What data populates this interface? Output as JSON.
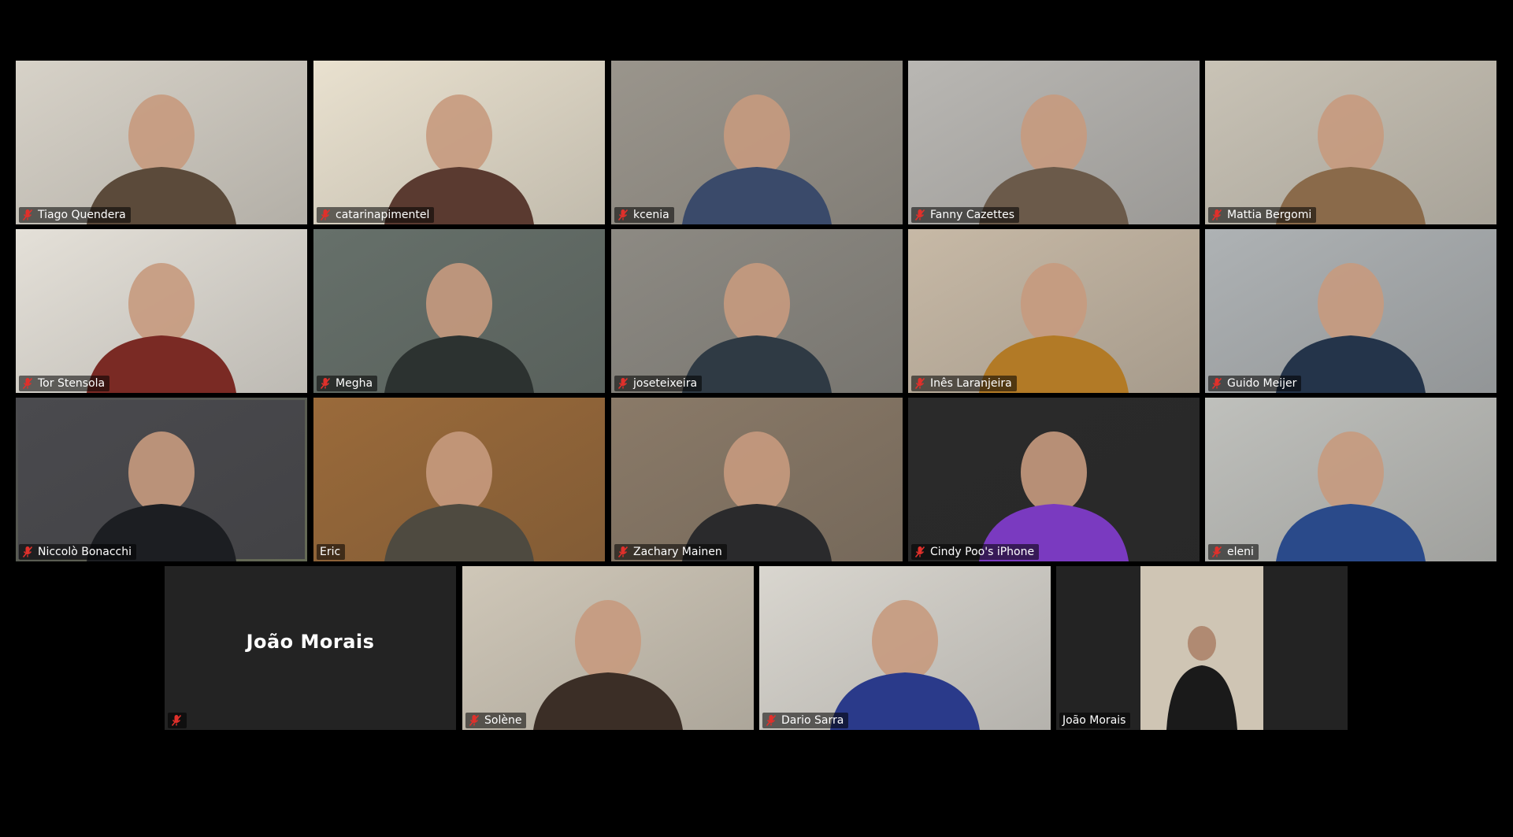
{
  "meeting": {
    "participants": [
      {
        "name": "Tiago Quendera",
        "muted": true,
        "bg": [
          "#d7d2c8",
          "#5b4a3a"
        ]
      },
      {
        "name": "catarinapimentel",
        "muted": true,
        "bg": [
          "#e9e1cf",
          "#5a3a30"
        ]
      },
      {
        "name": "kcenia",
        "muted": true,
        "bg": [
          "#9a958c",
          "#3a4a6a"
        ]
      },
      {
        "name": "Fanny Cazettes",
        "muted": true,
        "bg": [
          "#b9b7b3",
          "#6b5a4a"
        ]
      },
      {
        "name": "Mattia Bergomi",
        "muted": true,
        "bg": [
          "#c9c3b6",
          "#8a6a4a"
        ]
      },
      {
        "name": "Tor Stensola",
        "muted": true,
        "bg": [
          "#e4e0d8",
          "#7a2a24"
        ]
      },
      {
        "name": "Megha",
        "muted": true,
        "bg": [
          "#66706a",
          "#2c3230"
        ]
      },
      {
        "name": "joseteixeira",
        "muted": true,
        "bg": [
          "#8d8a83",
          "#2f3a44"
        ]
      },
      {
        "name": "Inês Laranjeira",
        "muted": true,
        "bg": [
          "#c7b9a6",
          "#b27a26"
        ]
      },
      {
        "name": "Guido Meijer",
        "muted": true,
        "bg": [
          "#aeb2b4",
          "#24344a"
        ]
      },
      {
        "name": "Niccolò Bonacchi",
        "muted": true,
        "active": true,
        "bg": [
          "#4a4a4e",
          "#1c1e22"
        ]
      },
      {
        "name": "Eric",
        "muted": false,
        "bg": [
          "#9a6a3a",
          "#4e4a40"
        ]
      },
      {
        "name": "Zachary Mainen",
        "muted": true,
        "bg": [
          "#8a7a68",
          "#2a2a2c"
        ]
      },
      {
        "name": "Cindy Poo's iPhone",
        "muted": true,
        "bg": [
          "#2a2a2a",
          "#7a3ac0"
        ]
      },
      {
        "name": "eleni",
        "muted": true,
        "bg": [
          "#bfc0bc",
          "#2a4a8a"
        ]
      },
      {
        "name": "",
        "display_name": "João Morais",
        "muted": true,
        "video_off": true
      },
      {
        "name": "Solène",
        "muted": true,
        "bg": [
          "#cfc7b8",
          "#3b2e26"
        ]
      },
      {
        "name": "Dario Sarra",
        "muted": true,
        "bg": [
          "#d9d6cf",
          "#2a3a8a"
        ]
      },
      {
        "name": "João Morais",
        "muted": false,
        "bg": [
          "#cfc5b4",
          "#1a1a1a"
        ],
        "portrait": true
      }
    ]
  },
  "colors": {
    "background": "#000000",
    "tile": "#232323",
    "active_speaker_outline": "#d9f277",
    "mute_icon": "#e0302b"
  },
  "icons": {
    "mute": "microphone-muted-icon"
  }
}
